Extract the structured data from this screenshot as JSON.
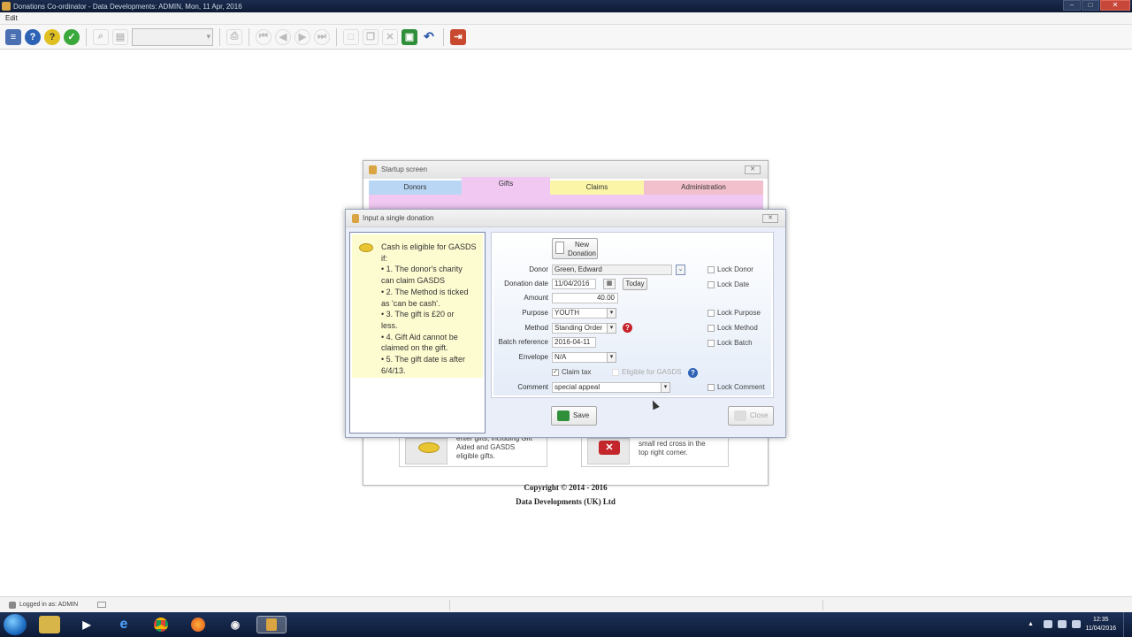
{
  "window": {
    "title": "Donations Co-ordinator - Data Developments: ADMIN, Mon, 11 Apr, 2016",
    "min_label": "–",
    "max_label": "□",
    "close_label": "✕"
  },
  "menu": {
    "edit": "Edit"
  },
  "toolbar": {
    "icons": [
      "list-icon",
      "help-icon",
      "question-icon",
      "check-icon",
      "search-icon",
      "page-icon",
      "print-icon",
      "first-icon",
      "prev-icon",
      "next-icon",
      "last-icon",
      "new-icon",
      "copy-icon",
      "delete-icon",
      "save-icon",
      "undo-icon",
      "exit-icon"
    ],
    "combo_value": ""
  },
  "startup": {
    "title": "Startup screen",
    "close_label": "✕",
    "tabs": [
      "Donors",
      "Gifts",
      "Claims",
      "Administration"
    ],
    "card_left_text": [
      "enter gifts, including Gift",
      "Aided and GASDS",
      "eligible gifts."
    ],
    "card_right_text": [
      "small red cross in the",
      "top right corner."
    ],
    "copyright": "Copyright © 2014 - 2016",
    "company": "Data Developments (UK) Ltd"
  },
  "dialog": {
    "title": "Input a single donation",
    "close_label": "✕",
    "info_lines": [
      "Cash is eligible for GASDS",
      "if:",
      "• 1. The donor's charity",
      "can claim GASDS",
      "• 2. The Method is ticked",
      "as 'can be cash'.",
      "• 3. The gift is £20 or",
      "less.",
      "• 4. Gift Aid cannot be",
      "claimed on the gift.",
      "• 5. The gift date is after",
      "6/4/13."
    ],
    "new_donation_label": "New",
    "new_donation_label2": "Donation",
    "fields": {
      "donor_label": "Donor",
      "donor_value": "Green, Edward",
      "date_label": "Donation date",
      "date_value": "11/04/2016",
      "today_label": "Today",
      "amount_label": "Amount",
      "amount_value": "40.00",
      "purpose_label": "Purpose",
      "purpose_value": "YOUTH",
      "method_label": "Method",
      "method_value": "Standing Order",
      "batch_label": "Batch reference",
      "batch_value": "2016-04-11",
      "envelope_label": "Envelope",
      "envelope_value": "N/A",
      "claim_tax_label": "Claim tax",
      "eligible_label": "Eligible for GASDS",
      "comment_label": "Comment",
      "comment_value": "special appeal"
    },
    "locks": {
      "donor": "Lock Donor",
      "date": "Lock Date",
      "purpose": "Lock Purpose",
      "method": "Lock Method",
      "batch": "Lock Batch",
      "comment": "Lock Comment"
    },
    "save_label": "Save",
    "close_btn_label": "Close"
  },
  "status": {
    "logged_in": "Logged in as: ADMIN"
  },
  "taskbar": {
    "time": "12:35",
    "date": "11/04/2016"
  },
  "colors": {
    "tab_donors": "#b9d7f5",
    "tab_gifts": "#f0c8f2",
    "tab_claims": "#fbf5a8",
    "tab_admin": "#f2c0cc",
    "info_bg": "#fdfbd0"
  }
}
